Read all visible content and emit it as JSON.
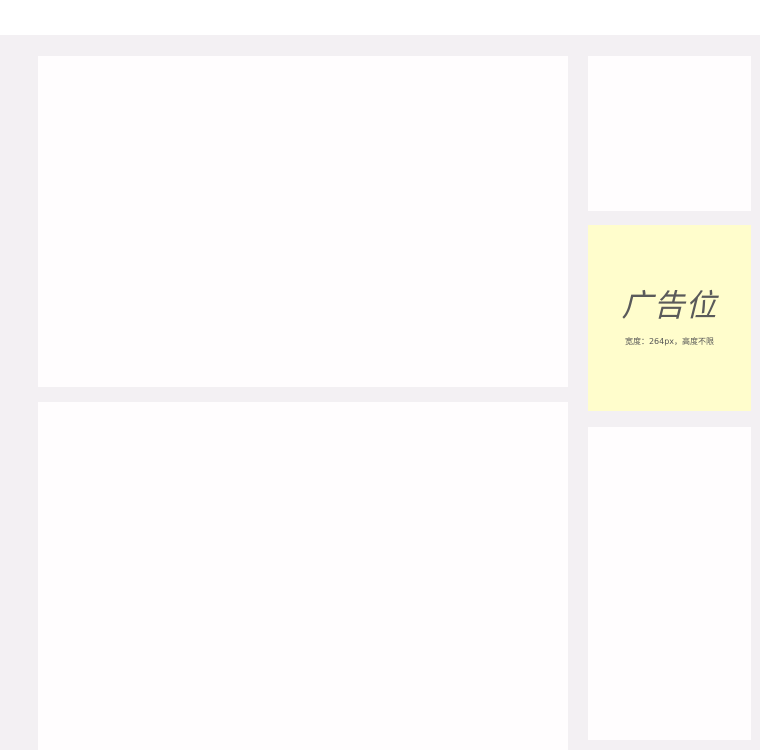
{
  "ad": {
    "title": "广告位",
    "description": "宽度：264px，高度不限"
  },
  "colors": {
    "page_background": "#f3f0f3",
    "panel_background": "#fffdfe",
    "ad_background": "#fffdcc",
    "ad_text": "#5a5a5a"
  }
}
